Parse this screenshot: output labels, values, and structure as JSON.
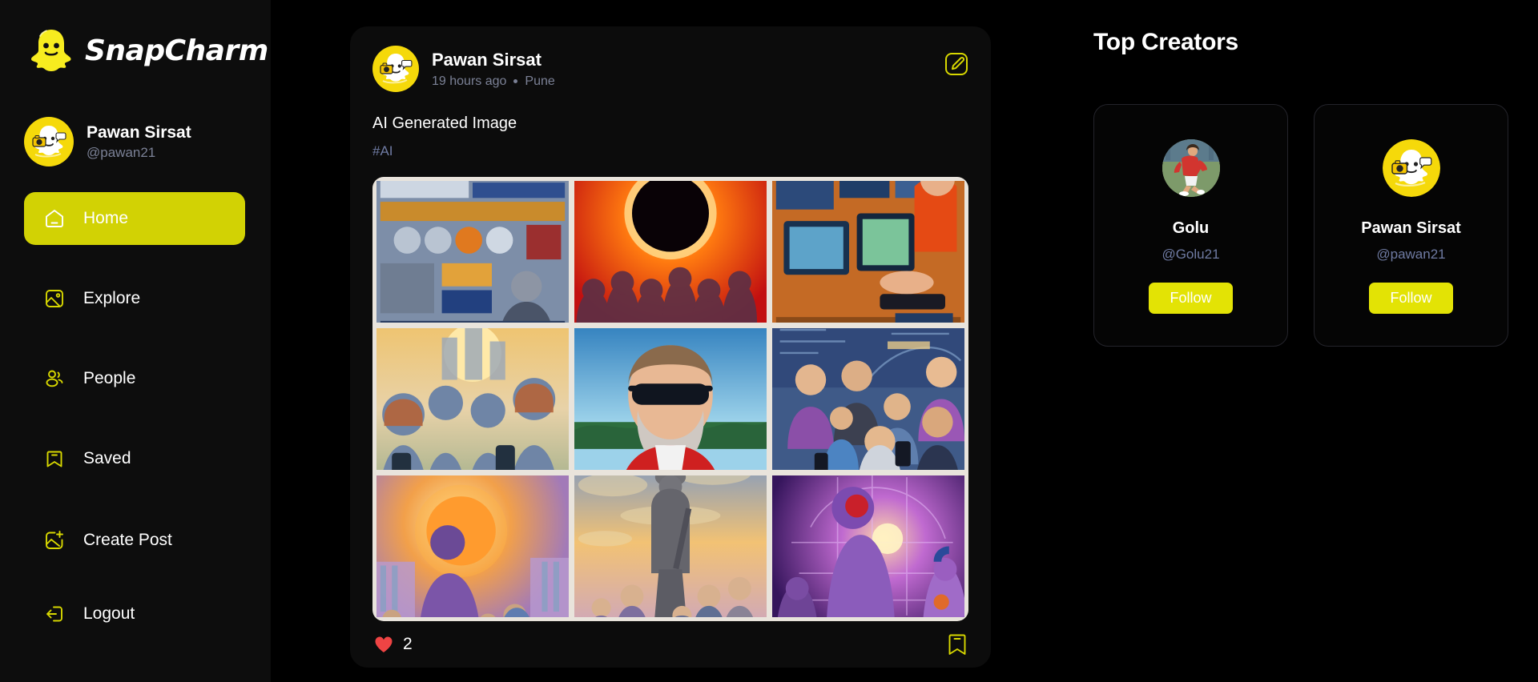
{
  "brand": {
    "name": "SnapCharm",
    "logo_icon": "ghost-icon"
  },
  "profile": {
    "name": "Pawan Sirsat",
    "handle": "@pawan21",
    "avatar_icon": "ghost-camera-avatar"
  },
  "sidebar": {
    "items": [
      {
        "label": "Home",
        "icon": "home-icon",
        "active": true
      },
      {
        "label": "Explore",
        "icon": "image-icon",
        "active": false
      },
      {
        "label": "People",
        "icon": "users-icon",
        "active": false
      },
      {
        "label": "Saved",
        "icon": "bookmark-icon",
        "active": false
      }
    ],
    "bottom_items": [
      {
        "label": "Create Post",
        "icon": "image-plus-icon",
        "active": false
      },
      {
        "label": "Logout",
        "icon": "logout-icon",
        "active": false
      }
    ]
  },
  "post": {
    "author": "Pawan Sirsat",
    "time": "19 hours ago",
    "separator": "•",
    "location": "Pune",
    "caption": "AI Generated Image",
    "tag": "#AI",
    "edit_icon": "edit-pencil-icon",
    "like_icon": "heart-icon",
    "like_count": "2",
    "save_icon": "bookmark-icon",
    "gallery": [
      {
        "alt": "newspaper collage with speaker",
        "theme": "blue-press"
      },
      {
        "alt": "solar eclipse over crowd",
        "theme": "orange-eclipse"
      },
      {
        "alt": "man at computer workstation",
        "theme": "orange-desk"
      },
      {
        "alt": "crowd with phones at sunrise",
        "theme": "golden-crowd"
      },
      {
        "alt": "bearded man with sunglasses",
        "theme": "blue-portrait"
      },
      {
        "alt": "group looking at phone",
        "theme": "purple-group"
      },
      {
        "alt": "figure before orange sun",
        "theme": "sunset-figure"
      },
      {
        "alt": "statue at dusk with onlookers",
        "theme": "dusk-statue"
      },
      {
        "alt": "purple astronaut scene",
        "theme": "violet-space"
      }
    ]
  },
  "right_panel": {
    "title": "Top Creators",
    "creators": [
      {
        "name": "Golu",
        "handle": "@Golu21",
        "follow_label": "Follow",
        "avatar_icon": "soccer-player-avatar"
      },
      {
        "name": "Pawan Sirsat",
        "handle": "@pawan21",
        "follow_label": "Follow",
        "avatar_icon": "ghost-camera-avatar"
      }
    ]
  },
  "colors": {
    "brand_yellow": "#f7f700",
    "active_nav": "#d2d204",
    "follow_yellow": "#e3e305",
    "handle_blue": "#6f7ba3",
    "heart_red": "#ef4444",
    "sidebar_bg": "#0d0d0d",
    "card_bg": "#0c0c0c"
  }
}
